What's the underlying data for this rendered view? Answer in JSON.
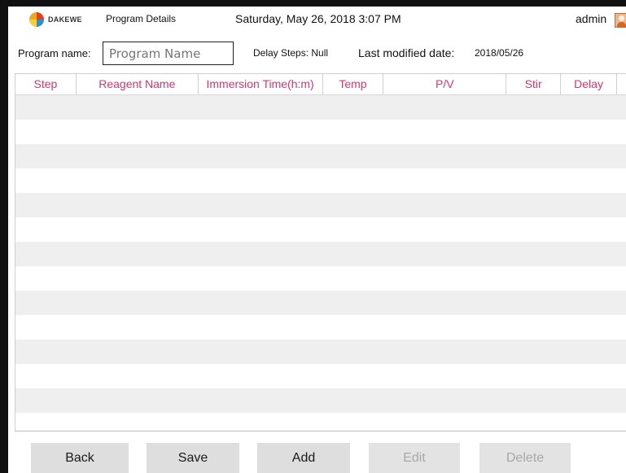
{
  "header": {
    "logo_text": "DAKEWE",
    "page_name": "Program Details",
    "datetime": "Saturday, May 26, 2018  3:07 PM",
    "user": "admin"
  },
  "info": {
    "program_name_label": "Program name:",
    "program_name_value": "",
    "program_name_placeholder": "Program Name",
    "delay_steps": "Delay Steps: Null",
    "last_modified_label": "Last modified date:",
    "last_modified_value": "2018/05/26"
  },
  "table": {
    "columns": [
      "Step",
      "Reagent Name",
      "Immersion Time(h:m)",
      "Temp",
      "P/V",
      "Stir",
      "Delay",
      ""
    ],
    "rows": []
  },
  "buttons": {
    "back": "Back",
    "save": "Save",
    "add": "Add",
    "edit": "Edit",
    "delete": "Delete"
  },
  "colors": {
    "column_header": "#e0326c",
    "row_shade": "#efefef",
    "button_bg": "#dedede",
    "button_disabled_text": "#a8a8a8"
  },
  "icons": [
    "dakewe-logo-icon",
    "user-avatar-icon"
  ]
}
